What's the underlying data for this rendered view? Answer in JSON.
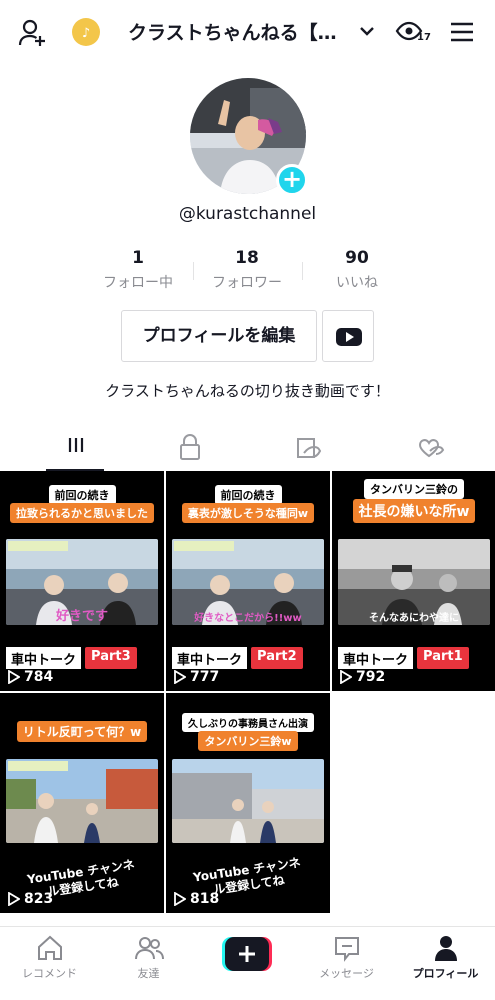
{
  "header": {
    "title": "クラストちゃんねる【…",
    "views_badge": "17"
  },
  "profile": {
    "handle": "@kurastchannel",
    "stats": [
      {
        "value": "1",
        "label": "フォロー中"
      },
      {
        "value": "18",
        "label": "フォロワー"
      },
      {
        "value": "90",
        "label": "いいね"
      }
    ],
    "edit_label": "プロフィールを編集",
    "bio": "クラストちゃんねるの切り抜き動画です！"
  },
  "videos": [
    {
      "line1": "前回の続き",
      "line2": "拉致られるかと思いました",
      "subtitle": "好きです",
      "tag_a": "車中トーク",
      "tag_b": "Part3",
      "views": "784"
    },
    {
      "line1": "前回の続き",
      "line2": "裏表が激しそうな種同w",
      "subtitle": "好きなとこだから!!ww",
      "tag_a": "車中トーク",
      "tag_b": "Part2",
      "views": "777"
    },
    {
      "line1": "タンバリン三鈴の",
      "line2": "社長の嫌いな所w",
      "subtitle": "そんなあにわや達に",
      "tag_a": "車中トーク",
      "tag_b": "Part1",
      "views": "792"
    },
    {
      "line1": "",
      "line2": "リトル反町って何？w",
      "subtitle": "YouTube チャンネル登録してね",
      "tag_a": "",
      "tag_b": "",
      "views": "823"
    },
    {
      "line1": "久しぶりの事務員さん出演",
      "line2": "タンバリン三鈴w",
      "subtitle": "YouTube チャンネル登録してね",
      "tag_a": "",
      "tag_b": "",
      "views": "818"
    }
  ],
  "bottom_nav": [
    {
      "label": "レコメンド"
    },
    {
      "label": "友達"
    },
    {
      "label": "メッセージ"
    },
    {
      "label": "プロフィール"
    }
  ]
}
